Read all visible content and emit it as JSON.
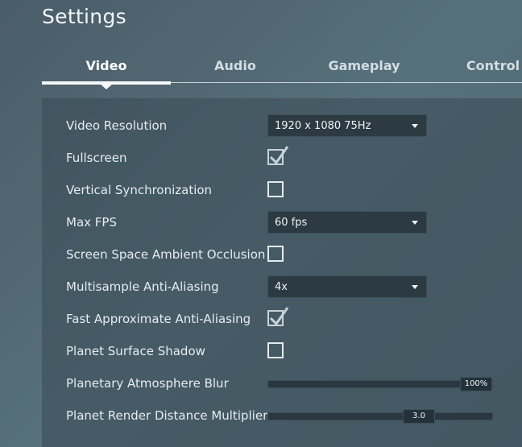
{
  "header": {
    "title": "Settings"
  },
  "tabs": [
    {
      "label": "Video",
      "active": true
    },
    {
      "label": "Audio",
      "active": false
    },
    {
      "label": "Gameplay",
      "active": false
    },
    {
      "label": "Control",
      "active": false
    }
  ],
  "settings": {
    "video_resolution": {
      "label": "Video Resolution",
      "value": "1920 x 1080  75Hz"
    },
    "fullscreen": {
      "label": "Fullscreen",
      "checked": true
    },
    "vsync": {
      "label": "Vertical Synchronization",
      "checked": false
    },
    "max_fps": {
      "label": "Max FPS",
      "value": "60 fps"
    },
    "ssao": {
      "label": "Screen Space Ambient Occlusion",
      "checked": false
    },
    "msaa": {
      "label": "Multisample Anti-Aliasing",
      "value": "4x"
    },
    "fxaa": {
      "label": "Fast Approximate Anti-Aliasing",
      "checked": true
    },
    "planet_shadow": {
      "label": "Planet Surface Shadow",
      "checked": false
    },
    "atmosphere_blur": {
      "label": "Planetary Atmosphere Blur",
      "value_text": "100%",
      "level": 1.0
    },
    "render_distance": {
      "label": "Planet Render Distance Multiplier",
      "value_text": "3.0",
      "level": 0.7
    }
  },
  "colors": {
    "background": "#56707c",
    "panel": "#3a4a54",
    "control_bg": "#2c3a42",
    "text": "#e6ecef",
    "accent": "#f5f7f8"
  },
  "icons": {
    "dropdown": "chevron-down-icon",
    "check": "checkmark-icon"
  }
}
